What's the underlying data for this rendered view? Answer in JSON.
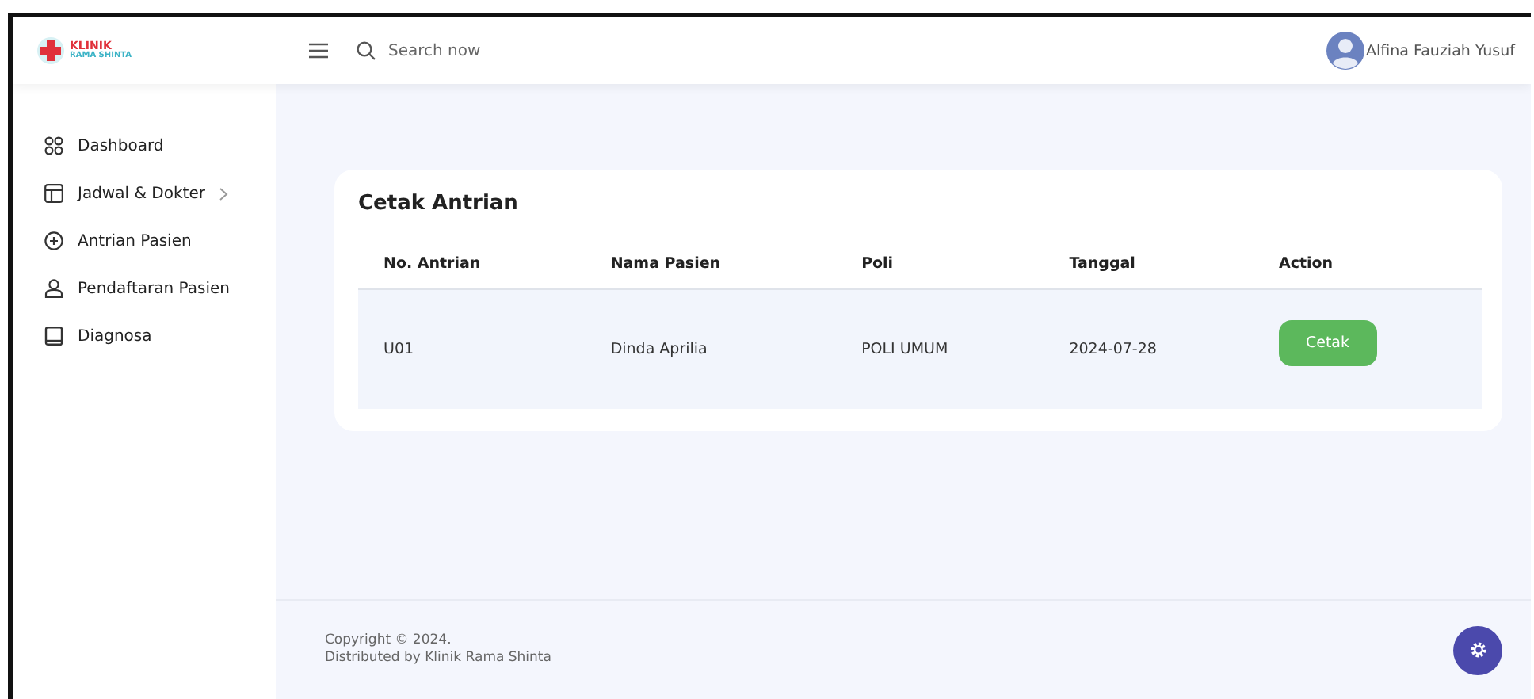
{
  "brand": {
    "line1": "KLINIK",
    "line2": "RAMA SHINTA"
  },
  "search": {
    "placeholder": "Search now"
  },
  "user": {
    "name": "Alfina Fauziah Yusuf"
  },
  "sidebar": {
    "items": [
      {
        "label": "Dashboard",
        "kind": "grid",
        "has_submenu": false
      },
      {
        "label": "Jadwal & Dokter",
        "kind": "layout",
        "has_submenu": true
      },
      {
        "label": "Antrian Pasien",
        "kind": "add",
        "has_submenu": false
      },
      {
        "label": "Pendaftaran Pasien",
        "kind": "person",
        "has_submenu": false
      },
      {
        "label": "Diagnosa",
        "kind": "book",
        "has_submenu": false
      }
    ]
  },
  "card": {
    "title": "Cetak Antrian",
    "table": {
      "columns": [
        "No. Antrian",
        "Nama Pasien",
        "Poli",
        "Tanggal",
        "Action"
      ],
      "rows": [
        {
          "cells": [
            "U01",
            "Dinda Aprilia",
            "POLI UMUM",
            "2024-07-28"
          ],
          "action": "Cetak"
        }
      ]
    }
  },
  "footer": {
    "copyright": "Copyright © 2024.",
    "distributed": "Distributed by Klinik Rama Shinta"
  }
}
